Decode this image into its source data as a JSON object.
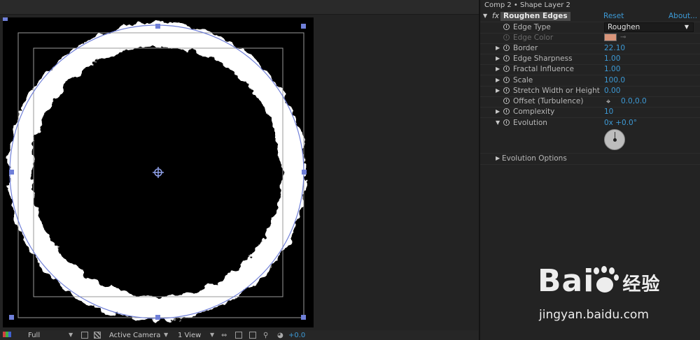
{
  "composition_panel": {
    "toolbar": {
      "resolution": "Full",
      "camera": "Active Camera",
      "views": "1 View",
      "exposure": "+0.0"
    }
  },
  "effect_panel": {
    "breadcrumb": "Comp 2 • Shape Layer 2",
    "effect": {
      "fx_label": "fx",
      "name": "Roughen Edges",
      "reset_label": "Reset",
      "about_label": "About..."
    },
    "properties": [
      {
        "label": "Edge Type",
        "value": "Roughen",
        "kind": "dropdown"
      },
      {
        "label": "Edge Color",
        "value": "",
        "kind": "color",
        "color": "#d9957a"
      },
      {
        "label": "Border",
        "value": "22.10",
        "kind": "number"
      },
      {
        "label": "Edge Sharpness",
        "value": "1.00",
        "kind": "number"
      },
      {
        "label": "Fractal Influence",
        "value": "1.00",
        "kind": "number"
      },
      {
        "label": "Scale",
        "value": "100.0",
        "kind": "number"
      },
      {
        "label": "Stretch Width or Height",
        "value": "0.00",
        "kind": "number"
      },
      {
        "label": "Offset (Turbulence)",
        "value": "0.0,0.0",
        "kind": "point"
      },
      {
        "label": "Complexity",
        "value": "10",
        "kind": "number"
      },
      {
        "label": "Evolution",
        "value": "0x +0.0°",
        "kind": "angle"
      }
    ],
    "evolution_options_label": "Evolution Options"
  },
  "watermark": {
    "logo_text_latin": "Bai",
    "logo_text_cjk": "经验",
    "url": "jingyan.baidu.com"
  },
  "colors": {
    "accent_value": "#3d9ad6",
    "panel_bg": "#232323",
    "canvas_bg": "#000000",
    "bounding_box": "#6f7fd8"
  }
}
